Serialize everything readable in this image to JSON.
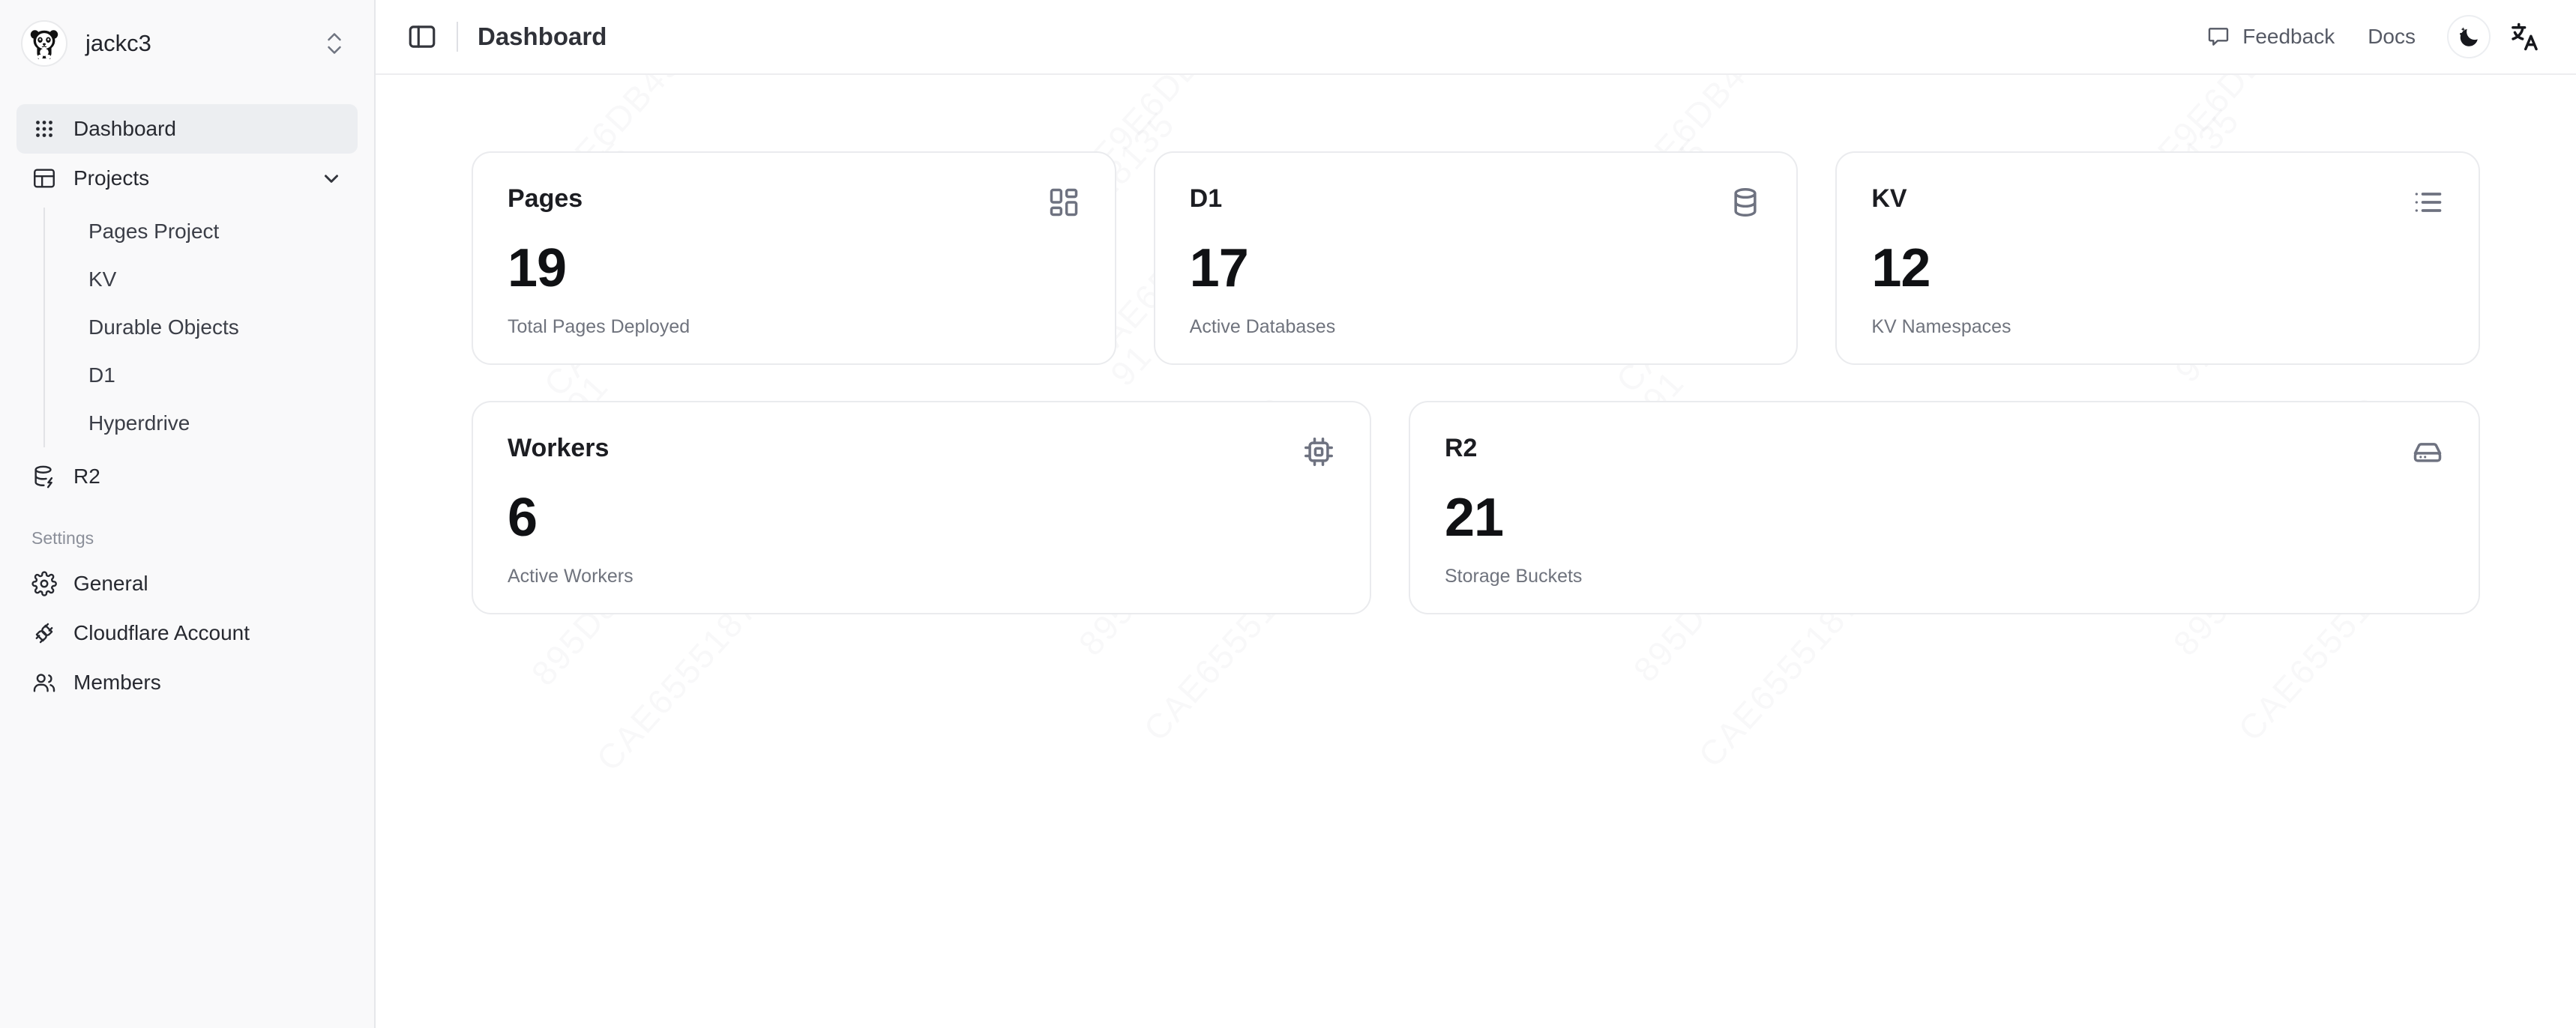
{
  "sidebar": {
    "account": {
      "name": "jackc3",
      "avatar_icon": "panda-avatar-icon",
      "switch_icon": "chevron-up-down-icon"
    },
    "items": [
      {
        "label": "Dashboard",
        "icon": "grid-dots-icon",
        "active": true
      },
      {
        "label": "Projects",
        "icon": "layout-panel-icon",
        "active": false,
        "expanded": true
      }
    ],
    "project_children": [
      {
        "label": "Pages Project"
      },
      {
        "label": "KV"
      },
      {
        "label": "Durable Objects"
      },
      {
        "label": "D1"
      },
      {
        "label": "Hyperdrive"
      }
    ],
    "standalone": [
      {
        "label": "R2",
        "icon": "database-bolt-icon"
      }
    ],
    "settings_label": "Settings",
    "settings_items": [
      {
        "label": "General",
        "icon": "gear-icon"
      },
      {
        "label": "Cloudflare Account",
        "icon": "plug-connector-icon"
      },
      {
        "label": "Members",
        "icon": "users-icon"
      }
    ]
  },
  "topbar": {
    "panel_toggle_icon": "sidebar-toggle-icon",
    "title": "Dashboard",
    "feedback_label": "Feedback",
    "feedback_icon": "chat-bubble-icon",
    "docs_label": "Docs",
    "theme_toggle_icon": "moon-stars-icon",
    "language_icon": "translate-icon"
  },
  "cards": {
    "row1": [
      {
        "title": "Pages",
        "value": "19",
        "subtitle": "Total Pages Deployed",
        "icon": "layout-dashboard-icon"
      },
      {
        "title": "D1",
        "value": "17",
        "subtitle": "Active Databases",
        "icon": "database-icon"
      },
      {
        "title": "KV",
        "value": "12",
        "subtitle": "KV Namespaces",
        "icon": "list-icon"
      }
    ],
    "row2": [
      {
        "title": "Workers",
        "value": "6",
        "subtitle": "Active Workers",
        "icon": "cpu-chip-icon"
      },
      {
        "title": "R2",
        "value": "21",
        "subtitle": "Storage Buckets",
        "icon": "hard-drive-icon"
      }
    ]
  },
  "watermark": {
    "lines": [
      "44F9E6DB49",
      "895D818135",
      "CAE6555187",
      "91"
    ]
  },
  "colors": {
    "sidebar_bg": "#f9f9fa",
    "active_item_bg": "#eceef1",
    "card_border": "#eaebee",
    "text_primary": "#1c1d22",
    "text_muted": "#6f737d",
    "icon_gray": "#6e7280"
  }
}
